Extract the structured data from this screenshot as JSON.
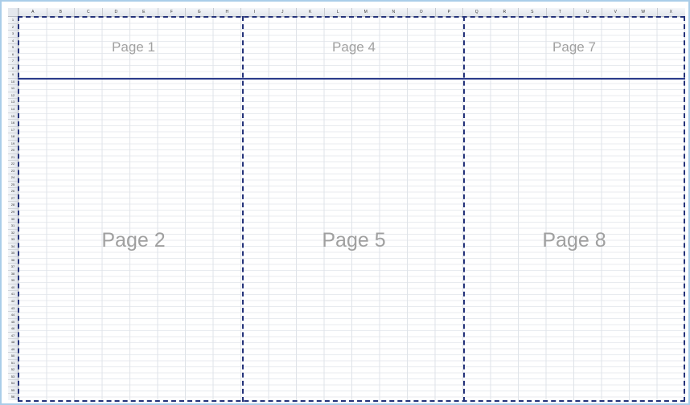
{
  "columns": [
    "A",
    "B",
    "C",
    "D",
    "E",
    "F",
    "G",
    "H",
    "I",
    "J",
    "K",
    "L",
    "M",
    "N",
    "O",
    "P",
    "Q",
    "R",
    "S",
    "T",
    "U",
    "V",
    "W",
    "X"
  ],
  "rows": [
    "1",
    "2",
    "3",
    "4",
    "5",
    "6",
    "7",
    "8",
    "9",
    "10",
    "11",
    "12",
    "13",
    "14",
    "15",
    "16",
    "17",
    "18",
    "19",
    "20",
    "21",
    "22",
    "23",
    "24",
    "25",
    "26",
    "27",
    "28",
    "29",
    "30",
    "31",
    "32",
    "33",
    "34",
    "35",
    "36",
    "37",
    "38",
    "39",
    "40",
    "41",
    "42",
    "43",
    "44",
    "45",
    "46",
    "47",
    "48",
    "49",
    "50",
    "51",
    "52",
    "53",
    "54",
    "55",
    "56"
  ],
  "pages": {
    "p1": "Page 1",
    "p4": "Page 4",
    "p7": "Page 7",
    "p2": "Page 2",
    "p5": "Page 5",
    "p8": "Page 8"
  },
  "colors": {
    "page_break": "#24327a",
    "frame": "#aacde9",
    "label": "#a0a0a0"
  }
}
